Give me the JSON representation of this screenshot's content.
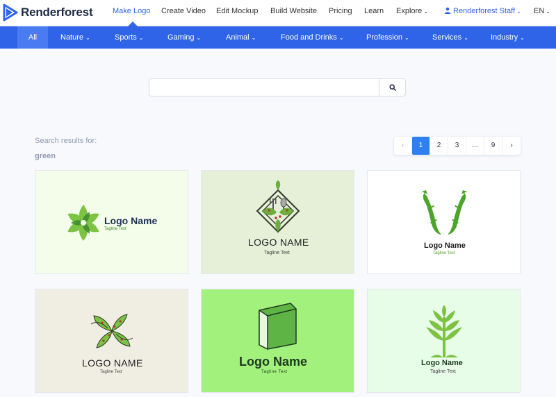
{
  "brand": {
    "name": "Renderforest"
  },
  "topnav": {
    "items": [
      {
        "label": "Make Logo",
        "active": true
      },
      {
        "label": "Create Video"
      },
      {
        "label": "Edit Mockup"
      },
      {
        "label": "Build Website"
      },
      {
        "label": "Pricing"
      },
      {
        "label": "Learn"
      },
      {
        "label": "Explore"
      }
    ],
    "user": "Renderforest Staff",
    "language": "EN"
  },
  "categories": [
    "All",
    "Nature",
    "Sports",
    "Gaming",
    "Animal",
    "Food and Drinks",
    "Profession",
    "Services",
    "Industry"
  ],
  "search": {
    "value": "",
    "placeholder": ""
  },
  "results": {
    "label": "Search results for:",
    "term": "green"
  },
  "pagination": {
    "pages": [
      "1",
      "2",
      "3",
      "...",
      "9"
    ],
    "current": "1"
  },
  "cards": [
    {
      "logo_name": "Logo Name",
      "tagline": "Tagline Text",
      "bg": "#f4fdea"
    },
    {
      "logo_name": "LOGO NAME",
      "tagline": "Tagline Text",
      "bg": "#e6efd8"
    },
    {
      "logo_name": "Logo Name",
      "tagline": "Tagline Text",
      "bg": "#ffffff"
    },
    {
      "logo_name": "LOGO NAME",
      "tagline": "Tagline Text",
      "bg": "#f0ede3"
    },
    {
      "logo_name": "Logo Name",
      "tagline": "Tagline Text",
      "bg": "#a3f17d"
    },
    {
      "logo_name": "Logo Name",
      "tagline": "Tagline Text",
      "bg": "#e8fde8"
    }
  ],
  "colors": {
    "accent": "#2f64e8",
    "page_bg": "#f7f9fd",
    "pager_active": "#2f7ff0"
  }
}
